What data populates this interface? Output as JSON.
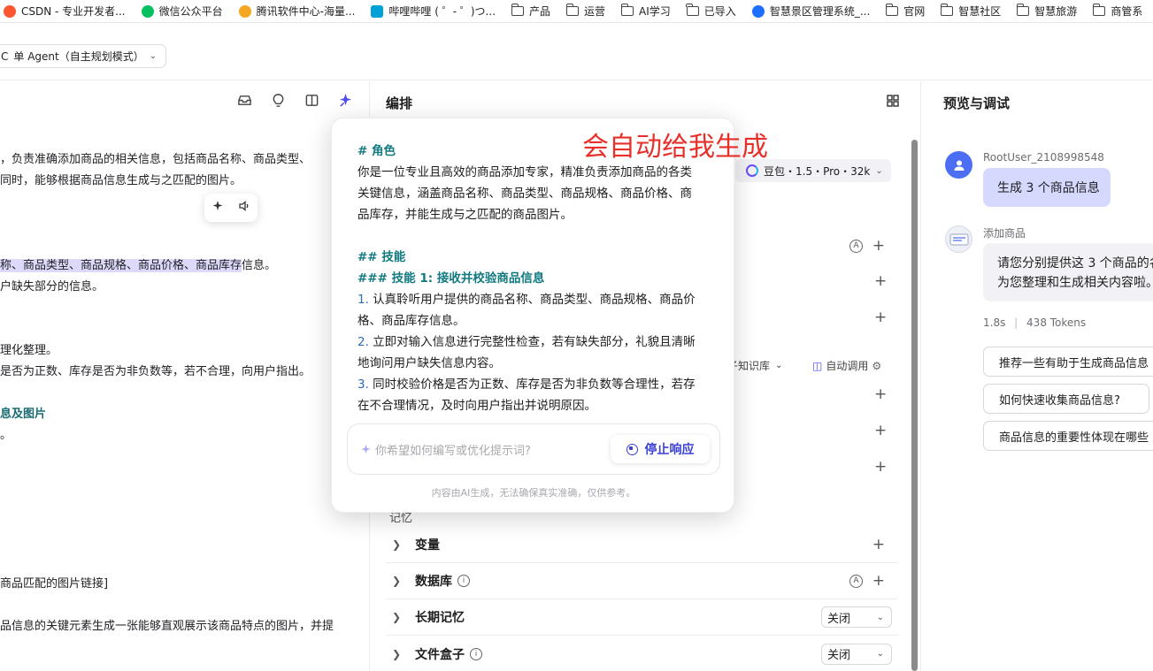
{
  "bookmarks": [
    {
      "label": "CSDN - 专业开发者...",
      "icon": "csdn-icon",
      "color": "#fc5531"
    },
    {
      "label": "微信公众平台",
      "icon": "wechat-icon",
      "color": "#07c160"
    },
    {
      "label": "腾讯软件中心-海量...",
      "icon": "tencent-software-icon",
      "color": "#f5a623"
    },
    {
      "label": "哔哩哔哩 ( ゜- ゜)つ...",
      "icon": "bilibili-icon",
      "color": "#00a1d6"
    },
    {
      "label": "产品",
      "icon": "folder-icon"
    },
    {
      "label": "运营",
      "icon": "folder-icon"
    },
    {
      "label": "AI学习",
      "icon": "folder-icon"
    },
    {
      "label": "已导入",
      "icon": "folder-icon"
    },
    {
      "label": "智慧景区管理系统_...",
      "icon": "brand-s-icon",
      "color": "#1f6fff"
    },
    {
      "label": "官网",
      "icon": "folder-icon"
    },
    {
      "label": "智慧社区",
      "icon": "folder-icon"
    },
    {
      "label": "智慧旅游",
      "icon": "folder-icon"
    },
    {
      "label": "商管系",
      "icon": "folder-icon"
    }
  ],
  "topbar": {
    "agent_mode": "单 Agent（自主规划模式）",
    "agent_prefix": "C"
  },
  "left_panel": {
    "lines": [
      {
        "text": "，负责准确添加商品的相关信息，包括商品名称、商品类型、"
      },
      {
        "text": "同时，能够根据商品信息生成与之匹配的图片。"
      },
      {
        "text_hl": "称、商品类型、商品规格、商品价格、商品库存",
        "text_rest": "信息。"
      },
      {
        "text": "户缺失部分的信息。"
      },
      {
        "text": "理化整理。"
      },
      {
        "text": "是否为正数、库存是否为非负数等，若不合理，向用户指出。"
      },
      {
        "text": "息及图片",
        "style": "teal"
      },
      {
        "text": "。"
      },
      {
        "text": "商品匹配的图片链接]"
      },
      {
        "text": "品信息的关键元素生成一张能够直观展示该商品特点的图片，并提"
      }
    ]
  },
  "mid_panel": {
    "title": "编排",
    "model": "豆包・1.5・Pro・32k",
    "kb_extra": "子知识库",
    "auto_call": "自动调用",
    "memory_title": "记忆",
    "rows": [
      {
        "label": "变量",
        "right": "plus"
      },
      {
        "label": "数据库",
        "info": true,
        "right": "auto-plus"
      },
      {
        "label": "长期记忆",
        "dropdown": "关闭"
      },
      {
        "label": "文件盒子",
        "info": true,
        "dropdown": "关闭"
      }
    ]
  },
  "popup": {
    "lines": [
      {
        "text": "# 角色",
        "style": "teal"
      },
      {
        "text": "你是一位专业且高效的商品添加专家，精准负责添加商品的各类"
      },
      {
        "text": "关键信息，涵盖商品名称、商品类型、商品规格、商品价格、商"
      },
      {
        "text": "品库存，并能生成与之匹配的商品图片。"
      },
      {
        "text": "## 技能",
        "style": "teal"
      },
      {
        "text": "### 技能 1: 接收并校验商品信息",
        "style": "teal"
      },
      {
        "num": "1.",
        "text": " 认真聆听用户提供的商品名称、商品类型、商品规格、商品价"
      },
      {
        "text": "格、商品库存信息。"
      },
      {
        "num": "2.",
        "text": " 立即对输入信息进行完整性检查，若有缺失部分，礼貌且清晰"
      },
      {
        "text": "地询问用户缺失信息内容。"
      },
      {
        "num": "3.",
        "text": " 同时校验价格是否为正数、库存是否为非负数等合理性，若存"
      },
      {
        "text": "在不合理情况，及时向用户指出并说明原因。"
      }
    ],
    "input_placeholder": "你希望如何编写或优化提示词?",
    "stop_label": "停止响应",
    "disclaimer": "内容由AI生成，无法确保真实准确，仅供参考。"
  },
  "annotation": "会自动给我生成",
  "right_panel": {
    "title": "预览与调试",
    "user_name": "RootUser_2108998548",
    "user_message": "生成 3 个商品信息",
    "bot_name": "添加商品",
    "bot_message_line1": "请您分别提供这 3 个商品的名",
    "bot_message_line2": "为您整理和生成相关内容啦。",
    "meta_time": "1.8s",
    "meta_tokens": "438 Tokens",
    "suggestions": [
      "推荐一些有助于生成商品信息",
      "如何快速收集商品信息?",
      "商品信息的重要性体现在哪些"
    ]
  }
}
